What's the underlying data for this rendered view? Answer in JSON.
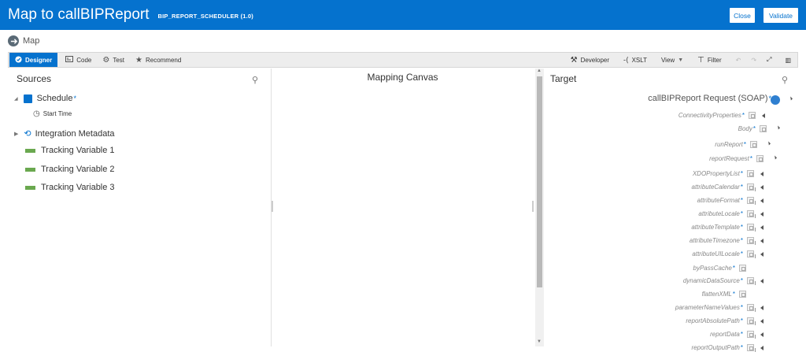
{
  "header": {
    "title": "Map to callBIPReport",
    "subtitle": "BIP_REPORT_SCHEDULER (1.0)",
    "close_label": "Close",
    "validate_label": "Validate"
  },
  "breadcrumb": {
    "label": "Map",
    "icon": "map-icon"
  },
  "toolbar": {
    "tabs": [
      {
        "label": "Designer",
        "icon": "designer-icon",
        "active": true
      },
      {
        "label": "Code",
        "icon": "code-icon"
      },
      {
        "label": "Test",
        "icon": "test-icon"
      },
      {
        "label": "Recommend",
        "icon": "star-icon"
      }
    ],
    "right": [
      {
        "label": "Developer",
        "icon": "developer-icon"
      },
      {
        "label": "XSLT",
        "icon": "xslt-icon"
      },
      {
        "label": "View",
        "icon": "chevron-down-icon"
      },
      {
        "label": "Filter",
        "icon": "filter-icon"
      }
    ]
  },
  "sources": {
    "title": "Sources",
    "items": [
      {
        "label": "Schedule",
        "required": "*",
        "icon": "calendar-icon"
      },
      {
        "label": "Start Time",
        "icon": "clock-icon"
      },
      {
        "label": "Integration Metadata",
        "icon": "metadata-icon"
      },
      {
        "label": "Tracking Variable 1",
        "icon": "tracking-variable-icon"
      },
      {
        "label": "Tracking Variable 2",
        "icon": "tracking-variable-icon"
      },
      {
        "label": "Tracking Variable 3",
        "icon": "tracking-variable-icon"
      }
    ]
  },
  "canvas": {
    "title": "Mapping Canvas"
  },
  "target": {
    "title": "Target",
    "root": "callBIPReport Request (SOAP)",
    "items": [
      {
        "label": "ConnectivityProperties",
        "req": "*"
      },
      {
        "label": "Body",
        "req": "*"
      },
      {
        "label": "runReport",
        "req": "*"
      },
      {
        "label": "reportRequest",
        "req": "*"
      },
      {
        "label": "XDOPropertyList",
        "req": "*"
      },
      {
        "label": "attributeCalendar",
        "req": "*"
      },
      {
        "label": "attributeFormat",
        "req": "*"
      },
      {
        "label": "attributeLocale",
        "req": "*"
      },
      {
        "label": "attributeTemplate",
        "req": "*"
      },
      {
        "label": "attributeTimezone",
        "req": "*"
      },
      {
        "label": "attributeUILocale",
        "req": "*"
      },
      {
        "label": "byPassCache",
        "req": "*"
      },
      {
        "label": "dynamicDataSource",
        "req": "*"
      },
      {
        "label": "flattenXML",
        "req": "*"
      },
      {
        "label": "parameterNameValues",
        "req": "*"
      },
      {
        "label": "reportAbsolutePath",
        "req": "*"
      },
      {
        "label": "reportData",
        "req": "*"
      },
      {
        "label": "reportOutputPath",
        "req": "*"
      }
    ]
  },
  "colors": {
    "brand": "#0572ce",
    "required": "#0572ce"
  }
}
